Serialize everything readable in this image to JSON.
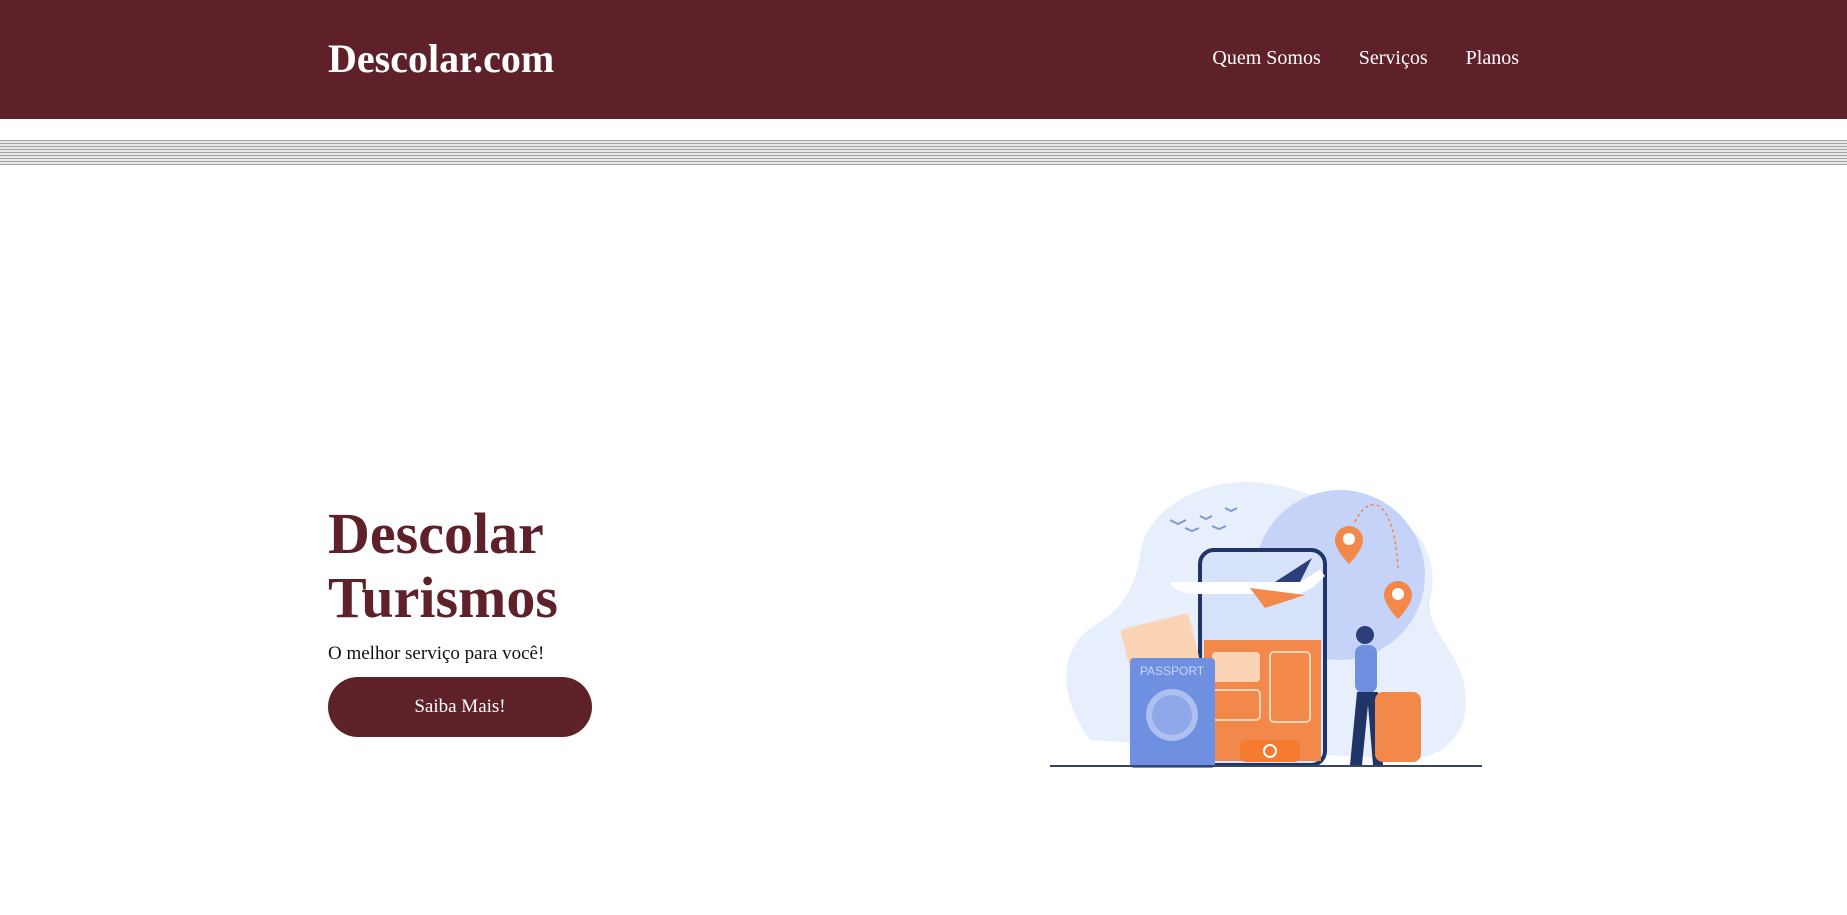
{
  "header": {
    "logo": "Descolar.com",
    "nav": [
      {
        "label": "Quem Somos"
      },
      {
        "label": "Serviços"
      },
      {
        "label": "Planos"
      }
    ]
  },
  "hero": {
    "title": "Descolar Turismos",
    "subtitle": "O melhor serviço para você!",
    "cta_label": "Saiba Mais!",
    "illustration_text": "PASSPORT"
  },
  "colors": {
    "brand": "#5e2129",
    "accent_orange": "#f2894a",
    "accent_blue": "#6f8fe0"
  }
}
